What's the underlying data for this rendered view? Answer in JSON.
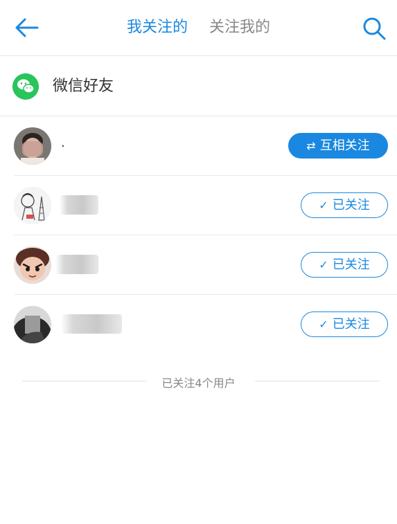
{
  "header": {
    "tabs": [
      {
        "label": "我关注的",
        "active": true
      },
      {
        "label": "关注我的",
        "active": false
      }
    ]
  },
  "wechat": {
    "label": "微信好友",
    "icon": "wechat-icon"
  },
  "users": [
    {
      "name": ".",
      "button": "互相关注",
      "button_icon": "⇄",
      "type": "mutual"
    },
    {
      "name": "",
      "button": "已关注",
      "button_icon": "✓",
      "type": "followed"
    },
    {
      "name": "",
      "button": "已关注",
      "button_icon": "✓",
      "type": "followed"
    },
    {
      "name": "",
      "button": "已关注",
      "button_icon": "✓",
      "type": "followed"
    }
  ],
  "footer": {
    "text": "已关注4个用户"
  },
  "colors": {
    "accent": "#1a88e0",
    "wechat": "#29c45c"
  }
}
